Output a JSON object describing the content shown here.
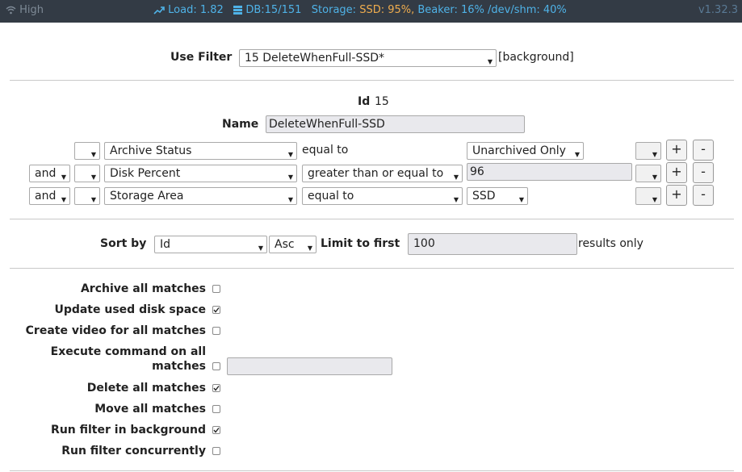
{
  "topbar": {
    "signal": "High",
    "load": "Load: 1.82",
    "db": "DB:15/151",
    "storage_label": "Storage:",
    "ssd": "SSD: 95%,",
    "beaker": "Beaker: 16%",
    "shm": "/dev/shm: 40%",
    "version": "v1.32.3",
    "colors": {
      "bar_bg": "#333b45",
      "accent": "#4fb3e8",
      "warning": "#f0ad4e"
    }
  },
  "filter": {
    "use_filter_label": "Use Filter",
    "selected": "15 DeleteWhenFull-SSD*",
    "background_tag": "[background]"
  },
  "details": {
    "id_label": "Id",
    "id_value": "15",
    "name_label": "Name",
    "name_value": "DeleteWhenFull-SSD"
  },
  "terms": [
    {
      "conj": "",
      "paren_open": "",
      "attr": "Archive Status",
      "op": "equal to",
      "value": "Unarchived Only",
      "paren_close": ""
    },
    {
      "conj": "and",
      "paren_open": "",
      "attr": "Disk Percent",
      "op": "greater than or equal to",
      "value": "96",
      "paren_close": ""
    },
    {
      "conj": "and",
      "paren_open": "",
      "attr": "Storage Area",
      "op": "equal to",
      "value": "SSD",
      "paren_close": ""
    }
  ],
  "buttons": {
    "add": "+",
    "remove": "-"
  },
  "sort": {
    "sort_by_label": "Sort by",
    "field": "Id",
    "direction": "Asc",
    "limit_label": "Limit to first",
    "limit_value": "100",
    "results_only": "results only"
  },
  "options": [
    {
      "label": "Archive all matches",
      "checked": false
    },
    {
      "label": "Update used disk space",
      "checked": true
    },
    {
      "label": "Create video for all matches",
      "checked": false
    },
    {
      "label": "Execute command on all",
      "label2": "matches",
      "checked": false
    },
    {
      "label": "Delete all matches",
      "checked": true
    },
    {
      "label": "Move all matches",
      "checked": false
    },
    {
      "label": "Run filter in background",
      "checked": true
    },
    {
      "label": "Run filter concurrently",
      "checked": false
    }
  ]
}
